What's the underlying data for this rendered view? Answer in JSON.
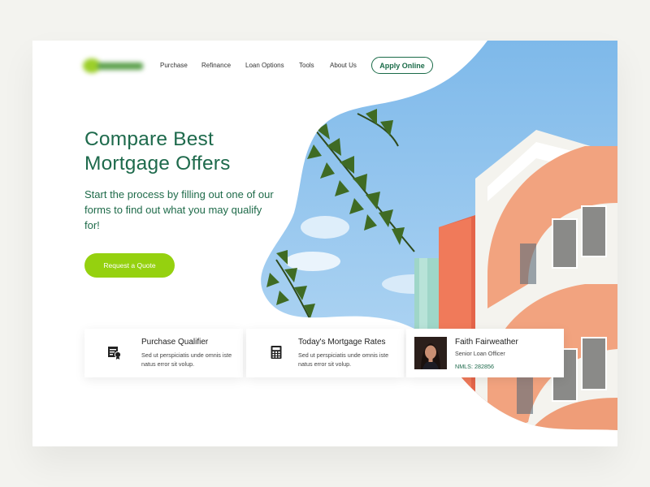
{
  "colors": {
    "brand_dark": "#1e6a4c",
    "accent_green": "#95d10f",
    "sky": "#8cc4ef",
    "building_salmon": "#f2a37f"
  },
  "nav": {
    "logo": "logo (blurred)",
    "items": [
      {
        "label": "Purchase"
      },
      {
        "label": "Refinance"
      },
      {
        "label": "Loan Options"
      },
      {
        "label": "Tools"
      },
      {
        "label": "About Us"
      }
    ],
    "apply_label": "Apply Online"
  },
  "hero": {
    "title": "Compare Best Mortgage Offers",
    "subtitle": "Start the process by filling out one of our forms to find out what you may qualify for!",
    "cta_label": "Request a Quote"
  },
  "cards": [
    {
      "icon": "certificate-icon",
      "title": "Purchase Qualifier",
      "text": "Sed ut perspiciatis unde omnis iste natus error sit volup."
    },
    {
      "icon": "calculator-icon",
      "title": "Today's Mortgage Rates",
      "text": "Sed ut perspiciatis unde omnis iste natus error sit volup."
    }
  ],
  "officer": {
    "name": "Faith Fairweather",
    "role": "Senior Loan Officer",
    "nmls": "NMLS: 282856"
  }
}
